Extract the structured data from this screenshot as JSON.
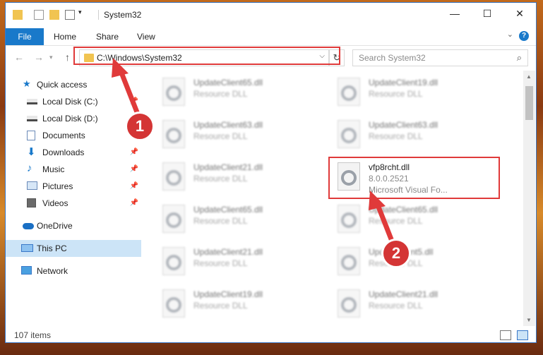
{
  "window": {
    "title": "System32"
  },
  "ribbon": {
    "tabs": [
      "File",
      "Home",
      "Share",
      "View"
    ],
    "help": "?"
  },
  "address": {
    "path": "C:\\Windows\\System32",
    "search_placeholder": "Search System32"
  },
  "sidebar": {
    "items": [
      {
        "label": "Quick access",
        "icon": "star-icon"
      },
      {
        "label": "Local Disk (C:)",
        "icon": "drive-icon"
      },
      {
        "label": "Local Disk (D:)",
        "icon": "drive-icon"
      },
      {
        "label": "Documents",
        "icon": "documents-icon"
      },
      {
        "label": "Downloads",
        "icon": "downloads-icon"
      },
      {
        "label": "Music",
        "icon": "music-icon"
      },
      {
        "label": "Pictures",
        "icon": "pictures-icon"
      },
      {
        "label": "Videos",
        "icon": "videos-icon"
      },
      {
        "label": "OneDrive",
        "icon": "cloud-icon"
      },
      {
        "label": "This PC",
        "icon": "computer-icon"
      },
      {
        "label": "Network",
        "icon": "network-icon"
      }
    ]
  },
  "files": [
    {
      "name": "UpdateClient65.dll",
      "type": "Resource DLL"
    },
    {
      "name": "UpdateClient19.dll",
      "type": "Resource DLL"
    },
    {
      "name": "UpdateClient63.dll",
      "type": "Resource DLL"
    },
    {
      "name": "UpdateClient63.dll",
      "type": "Resource DLL"
    },
    {
      "name": "UpdateClient21.dll",
      "type": "Resource DLL"
    },
    {
      "name": "vfp8rcht.dll",
      "version": "8.0.0.2521",
      "company": "Microsoft Visual Fo..."
    },
    {
      "name": "UpdateClient65.dll",
      "type": "Resource DLL"
    },
    {
      "name": "UpdateClient65.dll",
      "type": "Resource DLL"
    },
    {
      "name": "UpdateClient21.dll",
      "type": "Resource DLL"
    },
    {
      "name": "UpdateClient5.dll",
      "type": "Resource DLL"
    },
    {
      "name": "UpdateClient19.dll",
      "type": "Resource DLL"
    },
    {
      "name": "UpdateClient21.dll",
      "type": "Resource DLL"
    }
  ],
  "status": {
    "count": "107 items"
  },
  "annotations": {
    "step1": "1",
    "step2": "2"
  },
  "colors": {
    "accent": "#1979ca",
    "highlight": "#e03a3a"
  }
}
